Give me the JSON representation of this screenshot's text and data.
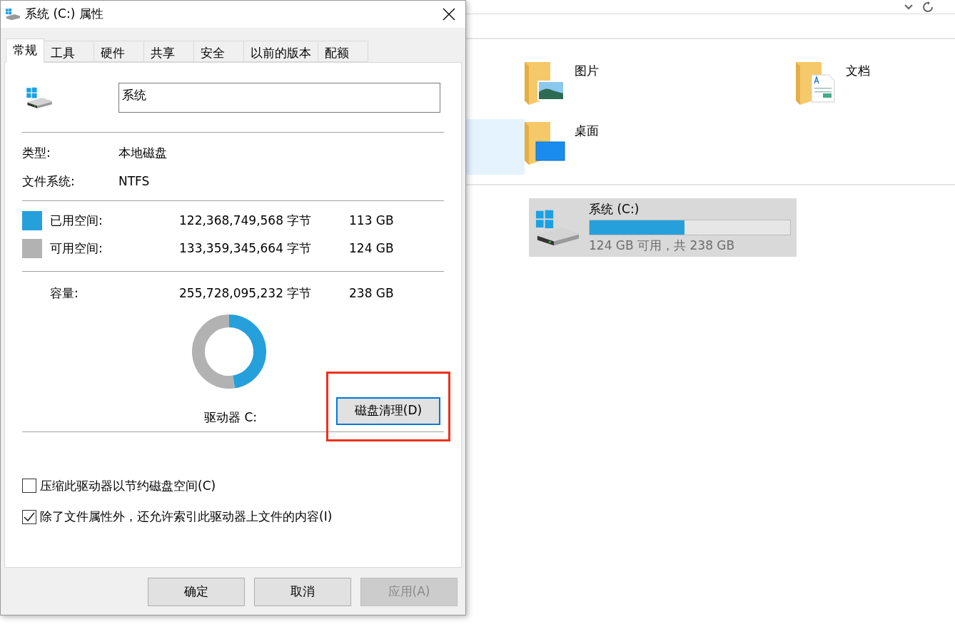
{
  "explorer": {
    "folders": [
      {
        "label": "图片",
        "kind": "pictures"
      },
      {
        "label": "文档",
        "kind": "documents"
      },
      {
        "label": "桌面",
        "kind": "desktop"
      }
    ],
    "drive": {
      "name": "系统 (C:)",
      "level": 0.475,
      "caption": "124 GB 可用，共 238 GB",
      "selected": true
    }
  },
  "dialog": {
    "title": "系统 (C:) 属性",
    "tabs": [
      {
        "label": "常规",
        "selected": true
      },
      {
        "label": "工具",
        "selected": false
      },
      {
        "label": "硬件",
        "selected": false
      },
      {
        "label": "共享",
        "selected": false
      },
      {
        "label": "安全",
        "selected": false
      },
      {
        "label": "以前的版本",
        "selected": false
      },
      {
        "label": "配额",
        "selected": false
      }
    ],
    "volume_name": "系统",
    "info": [
      {
        "label": "类型:",
        "value": "本地磁盘"
      },
      {
        "label": "文件系统:",
        "value": "NTFS"
      }
    ],
    "space": [
      {
        "label": "已用空间:",
        "bytes": "122,368,749,568 字节",
        "size": "113 GB",
        "color": "#26a0da"
      },
      {
        "label": "可用空间:",
        "bytes": "133,359,345,664 字节",
        "size": "124 GB",
        "color": "#b2b2b2"
      }
    ],
    "capacity": {
      "label": "容量:",
      "bytes": "255,728,095,232 字节",
      "size": "238 GB"
    },
    "usage": {
      "level": 0.475
    },
    "drive_label": "驱动器 C:",
    "cleanup_button": {
      "label": "磁盘清理(D)",
      "highlighted": true
    },
    "checkboxes": [
      {
        "label": "压缩此驱动器以节约磁盘空间(C)",
        "checked": false
      },
      {
        "label": "除了文件属性外，还允许索引此驱动器上文件的内容(I)",
        "checked": true
      }
    ],
    "buttons": [
      {
        "label": "确定",
        "disabled": false
      },
      {
        "label": "取消",
        "disabled": false
      },
      {
        "label": "应用(A)",
        "disabled": true
      }
    ]
  }
}
